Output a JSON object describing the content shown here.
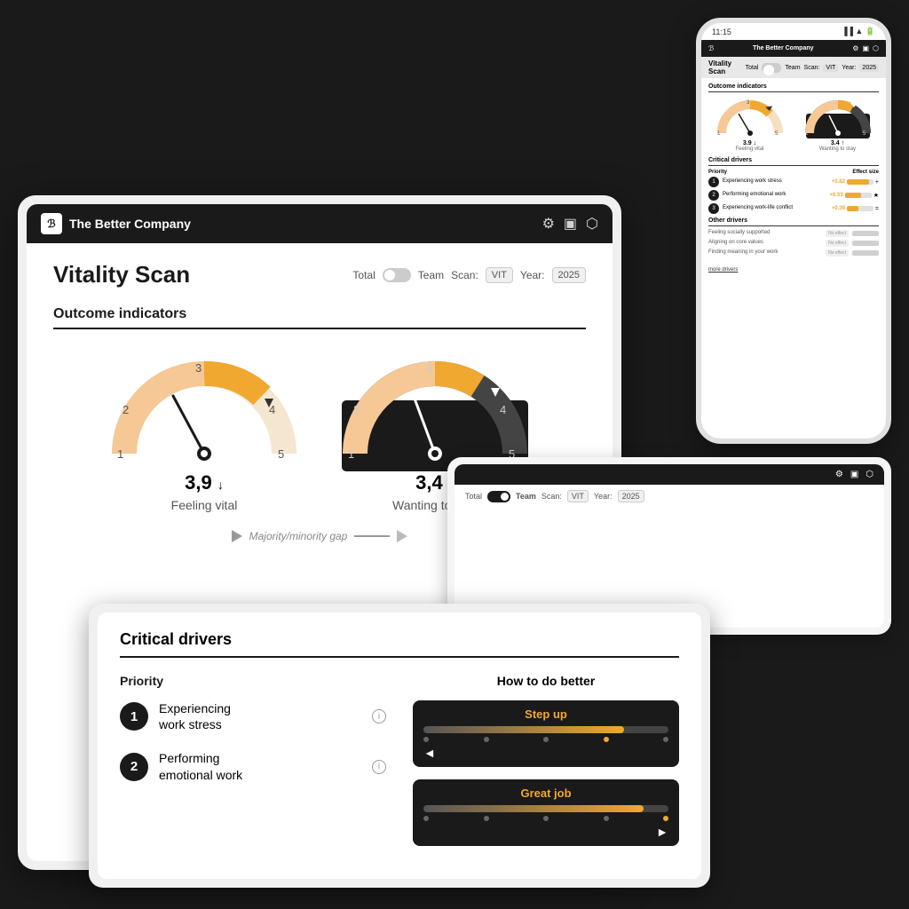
{
  "app": {
    "name": "The Better Company",
    "logo_text": "ℬ",
    "title": "Vitality Scan",
    "icons": [
      "⚙",
      "💾",
      "⬡"
    ]
  },
  "controls": {
    "total_label": "Total",
    "team_label": "Team",
    "scan_label": "Scan:",
    "scan_value": "VIT",
    "year_label": "Year:",
    "year_value": "2025"
  },
  "outcome_indicators": {
    "title": "Outcome indicators",
    "gauge1": {
      "value": "3,9",
      "trend": "↓",
      "label": "Feeling vital",
      "score": 3.9,
      "max": 5,
      "benchmark": 4
    },
    "gauge2": {
      "value": "3,4",
      "trend": "↑",
      "label": "Wanting to stay",
      "score": 3.4,
      "max": 5,
      "benchmark": 4
    },
    "majority_minority_label": "Majority/minority gap"
  },
  "critical_drivers": {
    "title": "Critical drivers",
    "priority_label": "Priority",
    "how_label": "How to do better",
    "drivers": [
      {
        "num": "1",
        "name": "Experiencing work stress",
        "effect": "+0.82",
        "bar_pct": 82,
        "badge": "Step up",
        "arrow_dir": "left"
      },
      {
        "num": "2",
        "name": "Performing emotional work",
        "effect": "+0.53",
        "bar_pct": 65,
        "badge": "Great job",
        "arrow_dir": "right"
      },
      {
        "num": "3",
        "name": "Experiencing work-life conflict",
        "effect": "+0.39",
        "bar_pct": 45,
        "badge": "=",
        "arrow_dir": "equal"
      }
    ]
  },
  "other_drivers": {
    "title": "Other drivers",
    "items": [
      {
        "name": "Feeling socially supported",
        "effect": "No effect"
      },
      {
        "name": "Aligning on core values",
        "effect": "No effect"
      },
      {
        "name": "Finding meaning in your work",
        "effect": "No effect"
      }
    ],
    "more_link": "more drivers"
  },
  "phone": {
    "time": "11:15",
    "scan_title": "Vitality Scan",
    "total_label": "Total",
    "team_label": "Team",
    "scan_label": "Scan:",
    "scan_val": "VIT",
    "year_label": "Year:",
    "year_val": "2025"
  },
  "bottom_card": {
    "team_active": true
  }
}
